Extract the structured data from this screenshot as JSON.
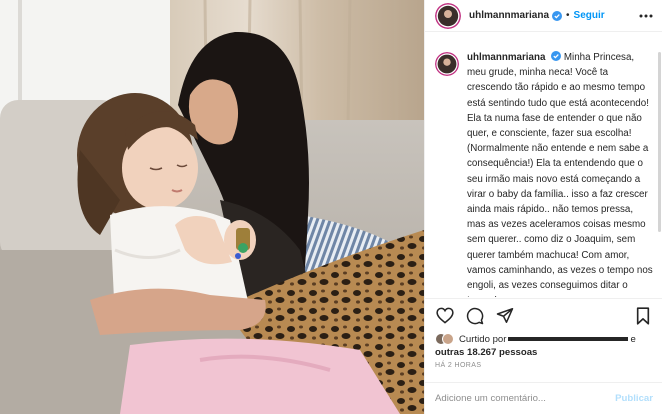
{
  "photo": {
    "description": "Mother kissing her young daughter who holds a small toy, sitting on a beige sofa"
  },
  "header": {
    "username": "uhlmannmariana",
    "separator": "•",
    "follow_label": "Seguir",
    "verified_icon": "verified-badge-icon",
    "more_icon": "more-options-icon"
  },
  "caption": {
    "username": "uhlmannmariana",
    "text": "Minha Princesa, meu grude, minha neca! Você ta crescendo tão rápido e ao mesmo tempo está sentindo tudo que está acontecendo! Ela ta numa fase de entender o que não quer, e consciente, fazer sua escolha! (Normalmente não entende e nem sabe a consequência!) Ela ta entendendo que o seu irmão mais novo está começando a virar o baby da família.. isso a faz crescer ainda mais rápido.. não temos pressa, mas as vezes aceleramos coisas mesmo sem querer.. como diz o Joaquim, sem querer também machuca! Com amor, vamos caminhando, as vezes o tempo nos engoli, as vezes conseguimos ditar o tempo!"
  },
  "actions": {
    "like_icon": "heart-icon",
    "comment_icon": "comment-icon",
    "share_icon": "share-icon",
    "save_icon": "bookmark-icon"
  },
  "likes": {
    "liked_by_prefix": "Curtido por",
    "liked_by_suffix": "e",
    "others_text": "outras 18.267 pessoas"
  },
  "timestamp": "Há 2 horas",
  "comment": {
    "placeholder": "Adicione um comentário...",
    "publish_label": "Publicar"
  },
  "colors": {
    "accent": "#0095f6",
    "publish_disabled": "#b2dffc",
    "text": "#262626",
    "muted": "#8e8e8e",
    "border": "#efefef"
  }
}
